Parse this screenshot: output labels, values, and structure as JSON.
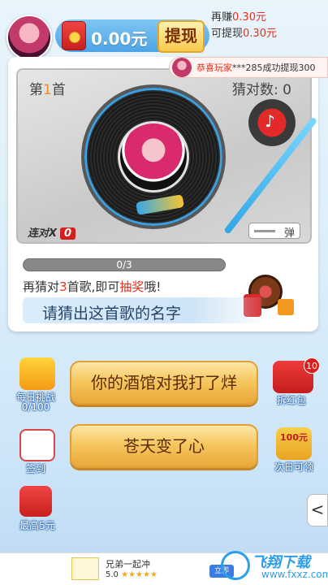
{
  "header": {
    "balance": "0.00元",
    "withdraw_label": "提现",
    "earn_more_prefix": "再赚",
    "earn_more_value": "0.30元",
    "withdrawable_prefix": "可提现",
    "withdrawable_value": "0.30元"
  },
  "notice": {
    "prefix": "恭喜玩家",
    "player": "***285",
    "suffix": "成功提现300"
  },
  "player": {
    "round_prefix": "第",
    "round_number": "1",
    "round_suffix": "首",
    "correct_label": "猜对数: 0",
    "streak_label": "连对X",
    "streak_value": "0",
    "toggle_label": "弹"
  },
  "progress": {
    "text": "0/3",
    "fraction": 0
  },
  "hint": {
    "part1": "再猜对",
    "count": "3",
    "part2": "首歌,即可",
    "reward": "抽奖",
    "part3": "哦!"
  },
  "question": "请猜出这首歌的名字",
  "answers": [
    "你的酒馆对我打了烊",
    "苍天变了心"
  ],
  "side_left": {
    "daily_challenge": "每日挑战",
    "daily_challenge_count": "0/100",
    "checkin": "签到",
    "max_reward": "最高5元"
  },
  "side_right": {
    "open_redpacket": "拆红包",
    "open_redpacket_badge": "10",
    "next_day_amount": "100元",
    "next_day": "次日可领"
  },
  "collapse": "<",
  "ad": {
    "title": "兄弟一起冲",
    "rating": "5.0",
    "stars": "★★★★★",
    "open_label": "立即"
  },
  "watermark": {
    "title": "飞翔下载",
    "url": "www.fxxz.com"
  },
  "colors": {
    "accent_red": "#e0321f",
    "answer_gold": "#f6c860",
    "primary_blue": "#4ea4e6"
  },
  "icons": {
    "wallet": "red-envelope-icon",
    "tonearm": "music-note-icon",
    "daily_challenge": "gift-icon",
    "checkin": "calendar-pen-icon",
    "max_reward": "red-envelope-icon",
    "open_redpacket": "red-envelope-icon",
    "next_day": "coin-envelope-icon"
  }
}
